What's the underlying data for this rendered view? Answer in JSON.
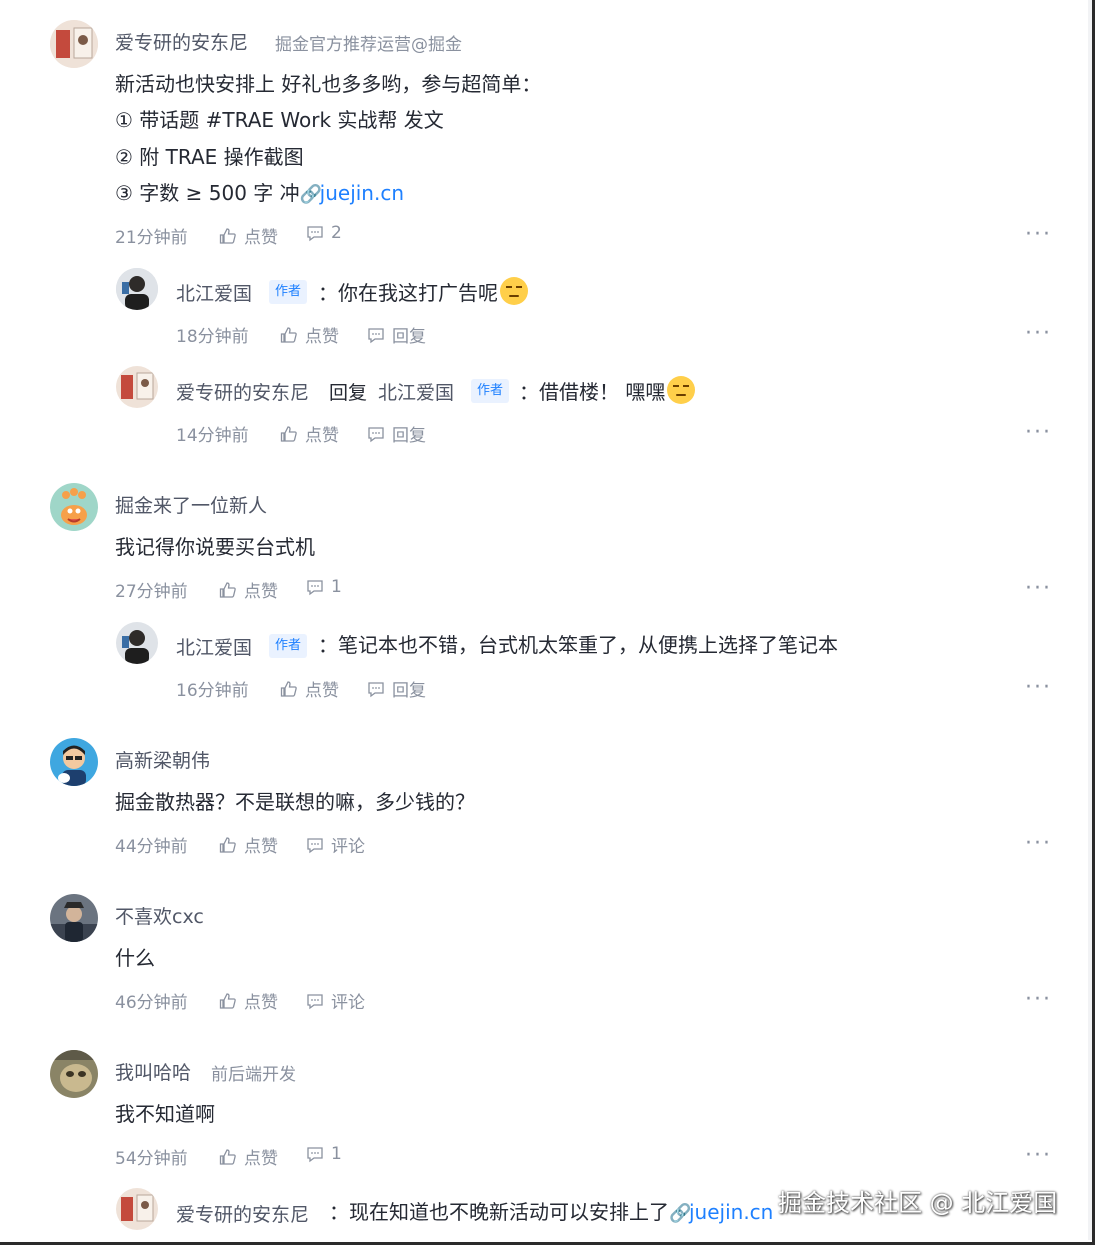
{
  "comments": [
    {
      "author": "爱专研的安东尼",
      "tagline": "掘金官方推荐运营@掘金",
      "lines": [
        "新活动也快安排上 好礼也多多哟，参与超简单：",
        "① 带话题 #TRAE Work 实战帮 发文",
        "② 附 TRAE 操作截图",
        "③ 字数 ≥ 500 字 冲"
      ],
      "link": "juejin.cn",
      "time": "21分钟前",
      "like": "点赞",
      "reply_count": "2",
      "replies": [
        {
          "author": "北江爱国",
          "badge": "作者",
          "text": "：你在我这打广告呢",
          "time": "18分钟前",
          "like": "点赞",
          "reply": "回复"
        },
        {
          "author": "爱专研的安东尼",
          "reply_word": "回复",
          "target": "北江爱国",
          "badge": "作者",
          "text": "：借借楼！ 嘿嘿",
          "time": "14分钟前",
          "like": "点赞",
          "reply": "回复"
        }
      ]
    },
    {
      "author": "掘金来了一位新人",
      "text": "我记得你说要买台式机",
      "time": "27分钟前",
      "like": "点赞",
      "reply_count": "1",
      "replies": [
        {
          "author": "北江爱国",
          "badge": "作者",
          "text": "：笔记本也不错，台式机太笨重了，从便携上选择了笔记本",
          "time": "16分钟前",
          "like": "点赞",
          "reply": "回复"
        }
      ]
    },
    {
      "author": "高新梁朝伟",
      "text": "掘金散热器？不是联想的嘛，多少钱的？",
      "time": "44分钟前",
      "like": "点赞",
      "comment": "评论"
    },
    {
      "author": "不喜欢cxc",
      "text": "什么",
      "time": "46分钟前",
      "like": "点赞",
      "comment": "评论"
    },
    {
      "author": "我叫哈哈",
      "tagline": "前后端开发",
      "text": "我不知道啊",
      "time": "54分钟前",
      "like": "点赞",
      "reply_count": "1",
      "replies": [
        {
          "author": "爱专研的安东尼",
          "text": "：现在知道也不晚新活动可以安排上了",
          "link": "juejin.cn"
        }
      ]
    }
  ],
  "more_label": "···",
  "watermark": "掘金技术社区 @ 北江爱国",
  "icons": {
    "like": "thumbs-up-icon",
    "comment": "comment-bubble-icon",
    "link": "link-icon",
    "more": "more-dots-icon"
  },
  "colors": {
    "link": "#1e80ff",
    "muted": "#8a919f",
    "text": "#252933",
    "badge_bg": "#eaf2ff"
  }
}
